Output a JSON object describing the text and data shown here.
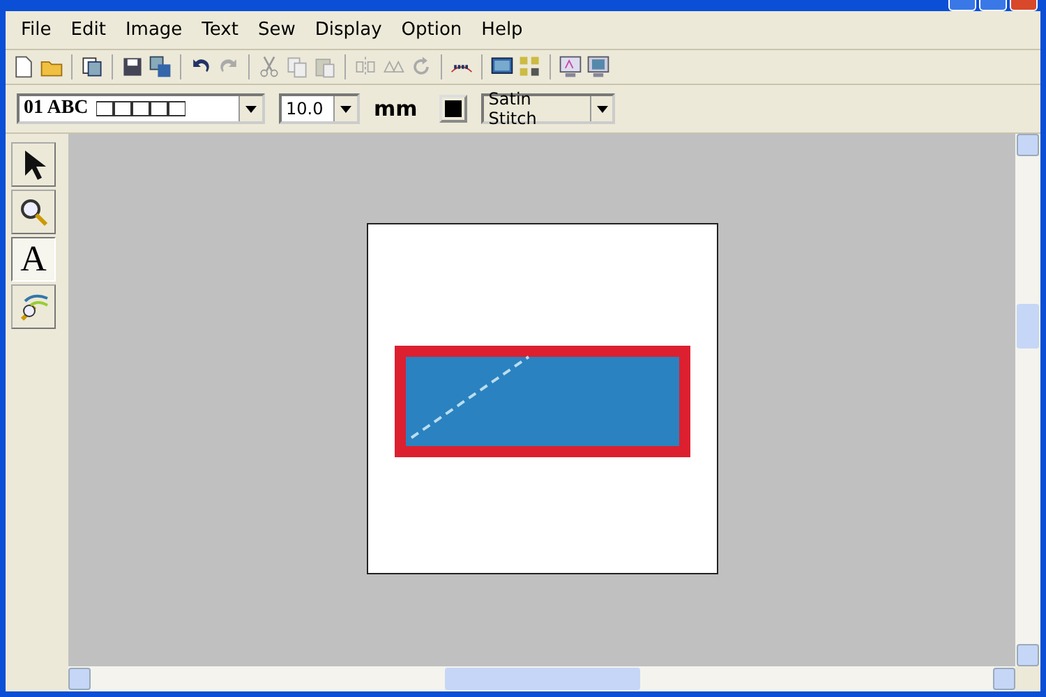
{
  "menu": [
    "File",
    "Edit",
    "Image",
    "Text",
    "Sew",
    "Display",
    "Option",
    "Help"
  ],
  "text_bar": {
    "font": "01 ABC",
    "size": "10.0",
    "unit": "mm",
    "stitch": "Satin Stitch"
  },
  "tools": [
    {
      "kind": "select",
      "selected": false
    },
    {
      "kind": "zoom",
      "selected": false
    },
    {
      "kind": "text",
      "label": "A",
      "selected": true
    },
    {
      "kind": "wand",
      "selected": false
    }
  ]
}
